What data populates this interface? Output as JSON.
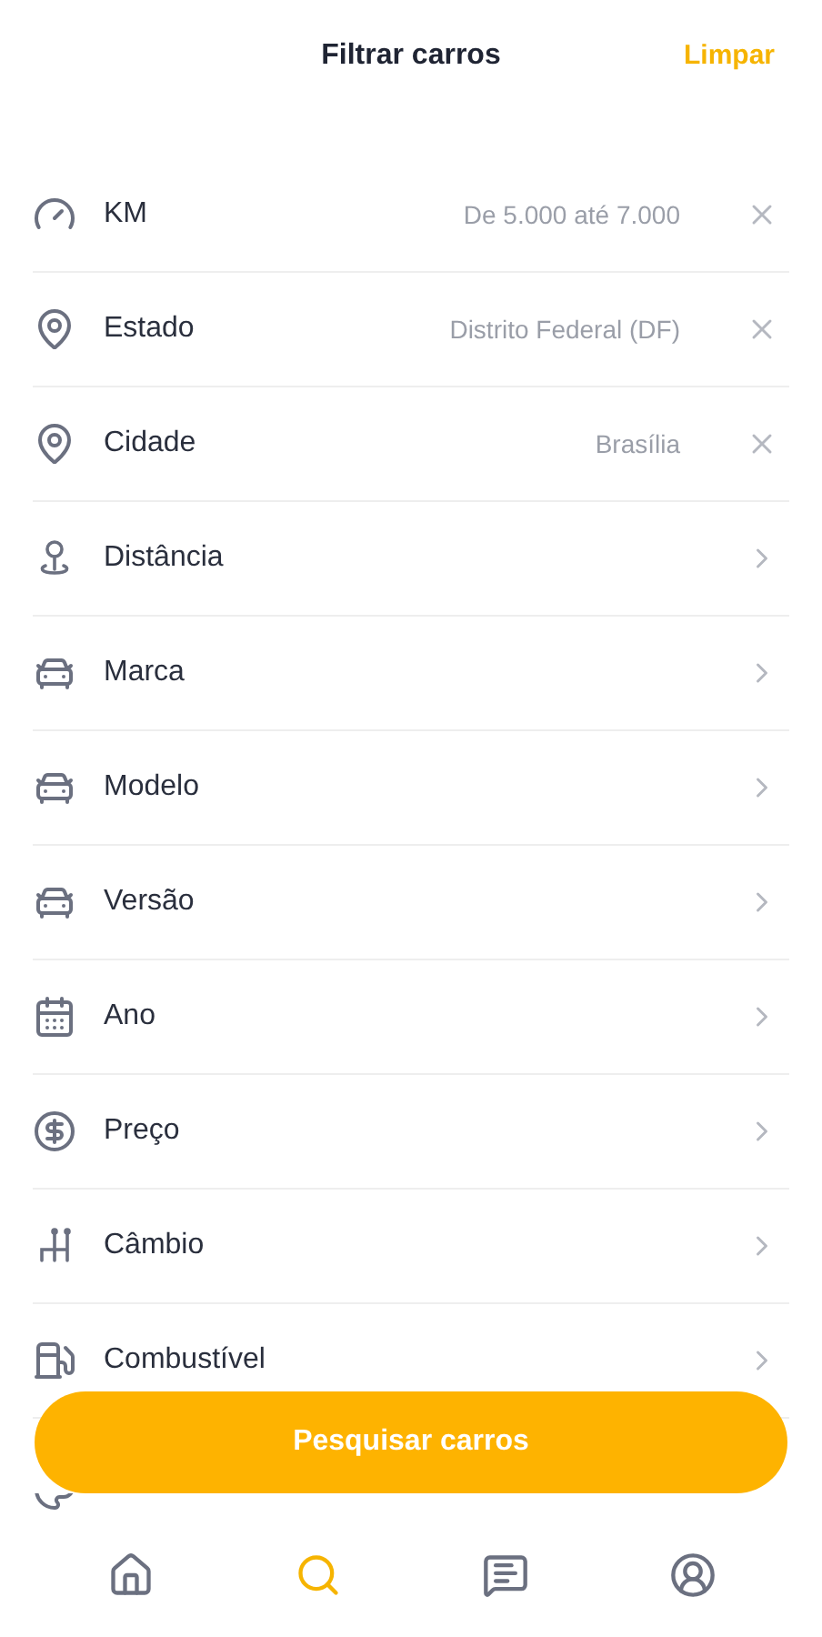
{
  "header": {
    "title": "Filtrar carros",
    "action": "Limpar"
  },
  "filters": [
    {
      "kind": "set",
      "label": "KM",
      "value": "De 5.000 até 7.000"
    },
    {
      "kind": "set",
      "label": "Estado",
      "value": "Distrito Federal (DF)"
    },
    {
      "kind": "set",
      "label": "Cidade",
      "value": "Brasília"
    },
    {
      "kind": "link",
      "label": "Distância"
    },
    {
      "kind": "link",
      "label": "Marca"
    },
    {
      "kind": "link",
      "label": "Modelo"
    },
    {
      "kind": "link",
      "label": "Versão"
    },
    {
      "kind": "link",
      "label": "Ano"
    },
    {
      "kind": "link",
      "label": "Preço"
    },
    {
      "kind": "link",
      "label": "Câmbio"
    },
    {
      "kind": "link",
      "label": "Combustível"
    },
    {
      "kind": "covered"
    }
  ],
  "search_button": "Pesquisar carros",
  "nav": [
    {
      "selected": false
    },
    {
      "selected": true
    },
    {
      "selected": false
    },
    {
      "selected": false
    }
  ]
}
